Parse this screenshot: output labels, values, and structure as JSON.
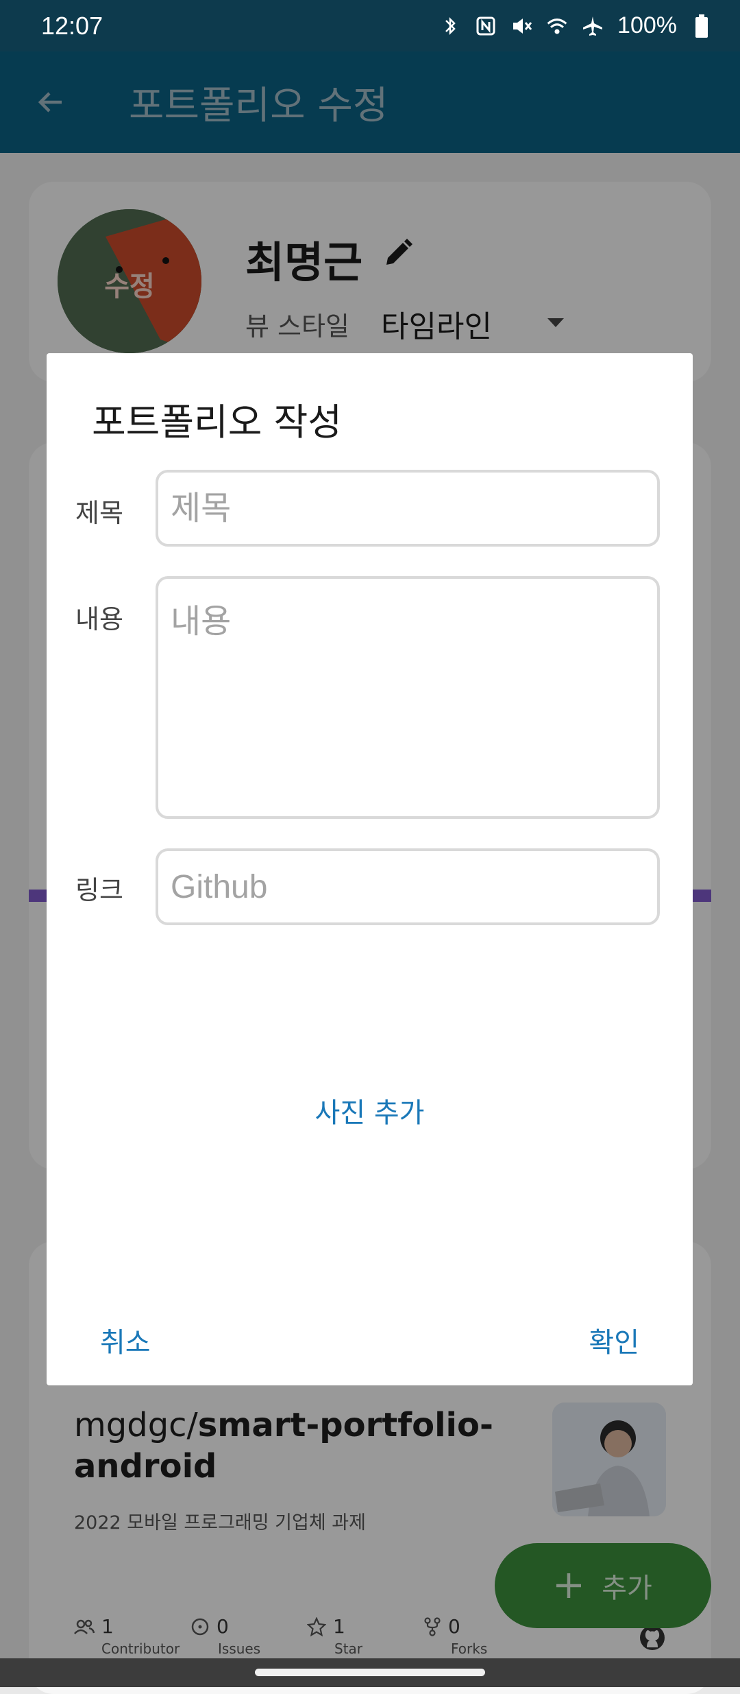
{
  "status_bar": {
    "time": "12:07",
    "battery": "100%",
    "icons": [
      "bluetooth-icon",
      "nfc-icon",
      "vibrate-icon",
      "wifi-icon",
      "airplane-icon",
      "battery-icon"
    ]
  },
  "app_bar": {
    "back_icon": "arrow-back-icon",
    "title": "포트폴리오 수정"
  },
  "profile": {
    "avatar_label": "수정",
    "name": "최명근",
    "edit_icon": "pencil-icon",
    "view_style_label": "뷰 스타일",
    "view_style_value": "타임라인"
  },
  "repo_card": {
    "owner": "mgdgc/",
    "name": "smart-portfolio-android",
    "description": "2022 모바일 프로그래밍 기업체 과제",
    "stats": [
      {
        "icon": "contributors-icon",
        "value": "1",
        "label": "Contributor"
      },
      {
        "icon": "issues-icon",
        "value": "0",
        "label": "Issues"
      },
      {
        "icon": "star-icon",
        "value": "1",
        "label": "Star"
      },
      {
        "icon": "fork-icon",
        "value": "0",
        "label": "Forks"
      }
    ]
  },
  "fab": {
    "icon": "plus-icon",
    "label": "추가"
  },
  "dialog": {
    "title": "포트폴리오 작성",
    "title_field": {
      "label": "제목",
      "placeholder": "제목",
      "value": ""
    },
    "content_field": {
      "label": "내용",
      "placeholder": "내용",
      "value": ""
    },
    "link_field": {
      "label": "링크",
      "placeholder": "Github",
      "value": ""
    },
    "add_photo": "사진 추가",
    "cancel": "취소",
    "confirm": "확인"
  },
  "colors": {
    "status_bar": "#0d3a4d",
    "app_bar": "#0b5f82",
    "accent": "#1a78b8",
    "fab": "#3b8d3b"
  }
}
